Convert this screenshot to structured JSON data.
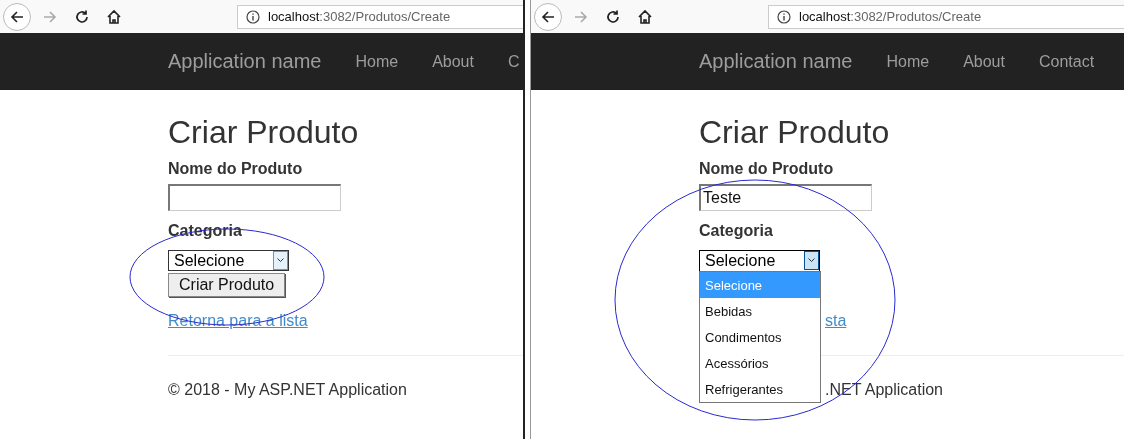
{
  "panes": [
    {
      "browser": {
        "forward_disabled": true,
        "url_host": "localhost",
        "url_rest": ":3082/Produtos/Create"
      },
      "navbar": {
        "brand": "Application name",
        "links": [
          "Home",
          "About",
          "C"
        ]
      },
      "page": {
        "title": "Criar Produto",
        "name_label": "Nome do Produto",
        "category_label": "Categoria",
        "select": {
          "value": "Selecione",
          "expanded": false
        },
        "submit": "Criar Produto",
        "back_link": "Retorna para a lista",
        "footer": "© 2018 - My ASP.NET Application"
      },
      "annotation": {
        "kind": "ellipse"
      }
    },
    {
      "browser": {
        "forward_disabled": true,
        "url_host": "localhost",
        "url_rest": ":3082/Produtos/Create"
      },
      "navbar": {
        "brand": "Application name",
        "links": [
          "Home",
          "About",
          "Contact"
        ]
      },
      "page": {
        "title": "Criar Produto",
        "name_label": "Nome do Produto",
        "name_value": "Teste",
        "category_label": "Categoria",
        "select": {
          "value": "Selecione",
          "expanded": true,
          "options": [
            {
              "label": "Selecione",
              "selected": true
            },
            {
              "label": "Bebidas",
              "selected": false
            },
            {
              "label": "Condimentos",
              "selected": false
            },
            {
              "label": "Acessórios",
              "selected": false
            },
            {
              "label": "Refrigerantes",
              "selected": false
            }
          ]
        },
        "back_link": "sta",
        "footer": ".NET Application"
      },
      "annotation": {
        "kind": "ellipse"
      }
    }
  ]
}
